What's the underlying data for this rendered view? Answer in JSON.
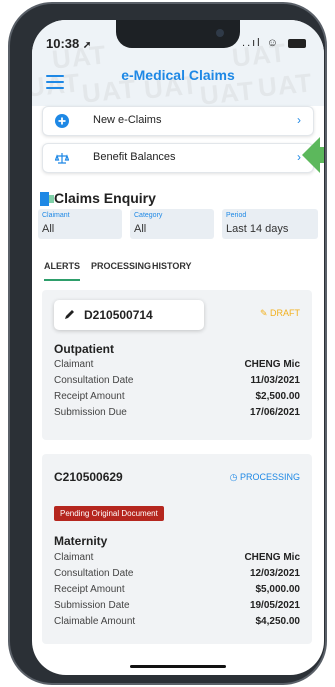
{
  "status_bar": {
    "time": "10:38",
    "signal": "..ıl"
  },
  "header": {
    "title": "e-Medical Claims",
    "watermark": "UAT"
  },
  "actions": [
    {
      "label": "New e-Claims",
      "icon": "plus-circle-icon"
    },
    {
      "label": "Benefit Balances",
      "icon": "scale-icon"
    }
  ],
  "enquiry": {
    "title": "Claims Enquiry",
    "filters": [
      {
        "label": "Claimant",
        "value": "All"
      },
      {
        "label": "Category",
        "value": "All"
      },
      {
        "label": "Period",
        "value": "Last 14 days"
      }
    ],
    "tabs": [
      "ALERTS",
      "PROCESSING",
      "HISTORY"
    ],
    "active_tab": "ALERTS"
  },
  "claims": [
    {
      "id": "D210500714",
      "status": "DRAFT",
      "type": "Outpatient",
      "fields": [
        {
          "k": "Claimant",
          "v": "CHENG Mic"
        },
        {
          "k": "Consultation Date",
          "v": "11/03/2021"
        },
        {
          "k": "Receipt Amount",
          "v": "$2,500.00"
        },
        {
          "k": "Submission Due",
          "v": "17/06/2021"
        }
      ]
    },
    {
      "id": "C210500629",
      "status": "PROCESSING",
      "badge": "Pending Original Document",
      "type": "Maternity",
      "fields": [
        {
          "k": "Claimant",
          "v": "CHENG Mic"
        },
        {
          "k": "Consultation Date",
          "v": "12/03/2021"
        },
        {
          "k": "Receipt Amount",
          "v": "$5,000.00"
        },
        {
          "k": "Submission Date",
          "v": "19/05/2021"
        },
        {
          "k": "Claimable Amount",
          "v": "$4,250.00"
        }
      ]
    }
  ],
  "colors": {
    "accent": "#1e88e5",
    "tab_active": "#2e9e6b",
    "draft": "#f2b01e",
    "badge": "#b5261e",
    "arrow": "#5cb85c"
  }
}
